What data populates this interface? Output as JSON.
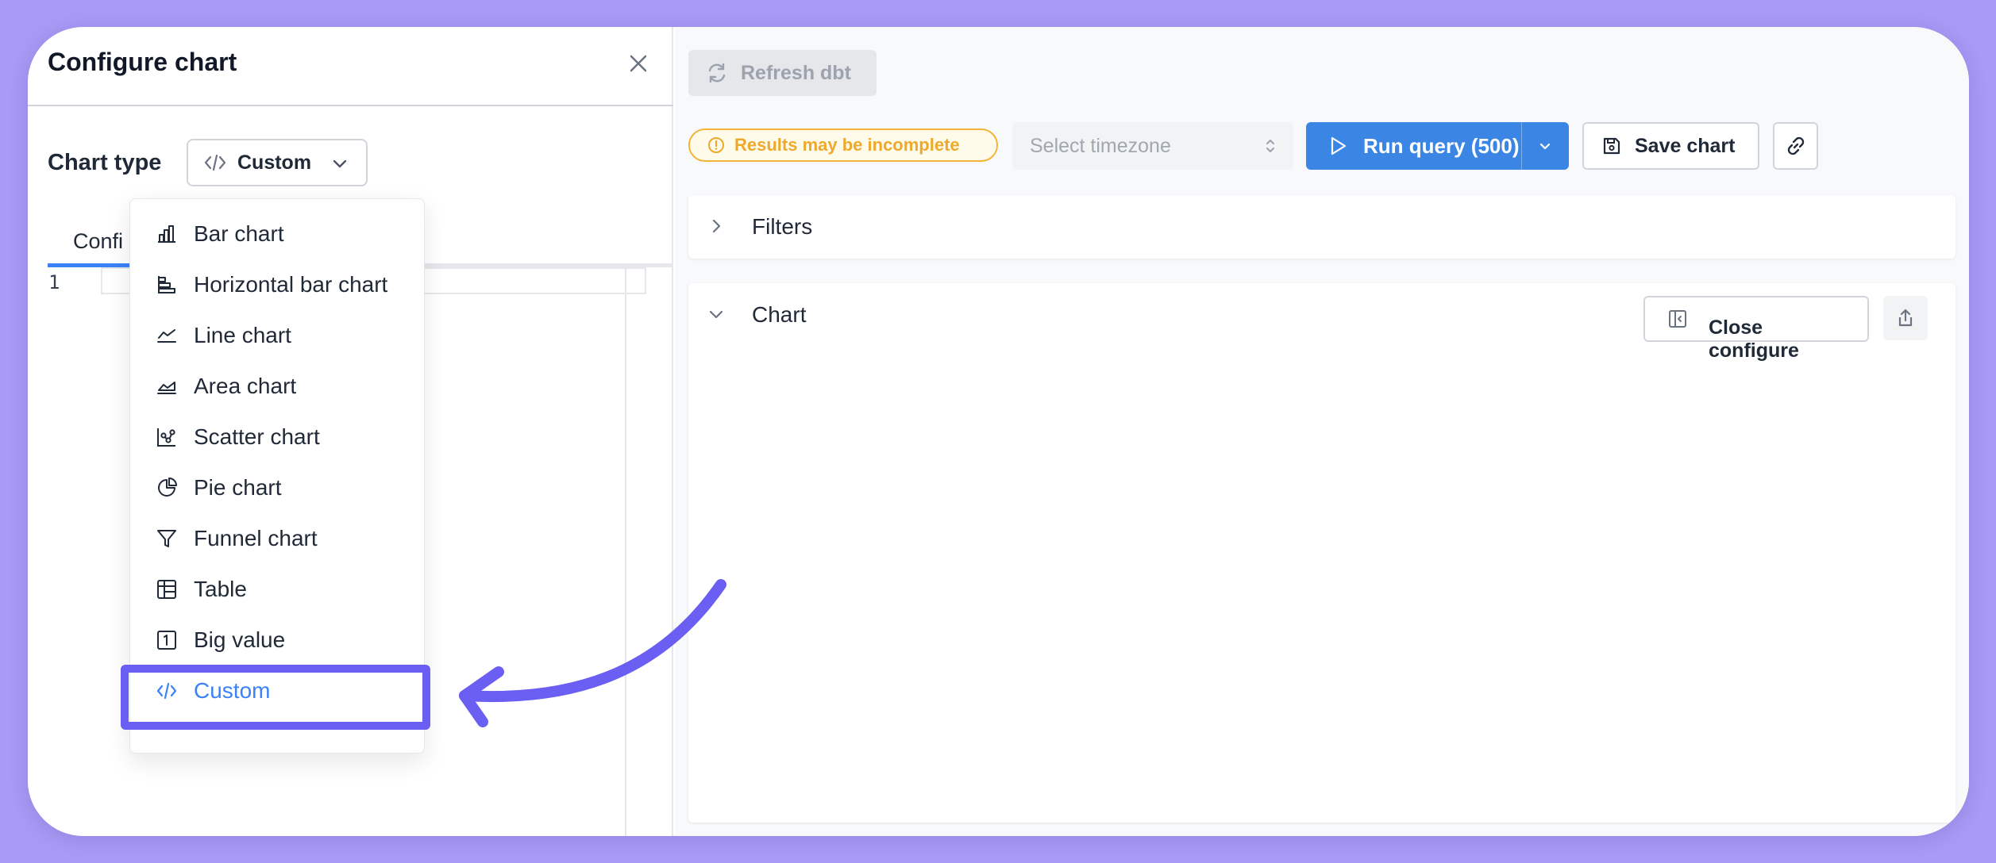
{
  "colors": {
    "background": "#a89af5",
    "accent": "#3b86e5",
    "annotation": "#6b5ef2",
    "warning": "#eea92d"
  },
  "panel": {
    "title": "Configure chart",
    "chart_type_label": "Chart type",
    "chart_type_value": "Custom",
    "tab_config": "Confi",
    "line_number": "1"
  },
  "dropdown": {
    "items": [
      {
        "label": "Bar chart",
        "icon": "bar-chart-icon"
      },
      {
        "label": "Horizontal bar chart",
        "icon": "horizontal-bar-chart-icon"
      },
      {
        "label": "Line chart",
        "icon": "line-chart-icon"
      },
      {
        "label": "Area chart",
        "icon": "area-chart-icon"
      },
      {
        "label": "Scatter chart",
        "icon": "scatter-chart-icon"
      },
      {
        "label": "Pie chart",
        "icon": "pie-chart-icon"
      },
      {
        "label": "Funnel chart",
        "icon": "funnel-chart-icon"
      },
      {
        "label": "Table",
        "icon": "table-icon"
      },
      {
        "label": "Big value",
        "icon": "big-value-icon"
      },
      {
        "label": "Custom",
        "icon": "code-icon",
        "selected": true
      }
    ]
  },
  "toolbar": {
    "refresh_label": "Refresh dbt",
    "warning_label": "Results may be incomplete",
    "timezone_placeholder": "Select timezone",
    "run_label": "Run query (500)",
    "save_label": "Save chart"
  },
  "sections": {
    "filters_label": "Filters",
    "chart_label": "Chart",
    "close_configure_label": "Close configure"
  }
}
